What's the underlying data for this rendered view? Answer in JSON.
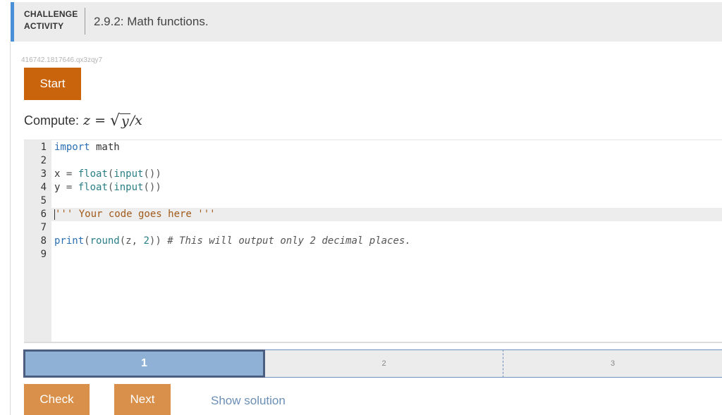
{
  "header": {
    "badge_line1": "CHALLENGE",
    "badge_line2": "ACTIVITY",
    "title": "2.9.2: Math functions.",
    "accent_color": "#4a90d9"
  },
  "activity_id": "416742.1817646.qx3zqy7",
  "start_button": {
    "label": "Start",
    "color": "#c9640c"
  },
  "prompt": {
    "label": "Compute:",
    "lhs": "z",
    "equals": "=",
    "radicand": "y",
    "divisor": "/x"
  },
  "editor": {
    "active_line": 6,
    "lines": [
      {
        "num": "1",
        "tokens": [
          {
            "t": "import",
            "c": "kw"
          },
          {
            "t": " math",
            "c": "plain"
          }
        ]
      },
      {
        "num": "2",
        "tokens": []
      },
      {
        "num": "3",
        "tokens": [
          {
            "t": "x ",
            "c": "plain"
          },
          {
            "t": "=",
            "c": "op"
          },
          {
            "t": " float",
            "c": "fn"
          },
          {
            "t": "(",
            "c": "op"
          },
          {
            "t": "input",
            "c": "fn"
          },
          {
            "t": "())",
            "c": "op"
          }
        ]
      },
      {
        "num": "4",
        "tokens": [
          {
            "t": "y ",
            "c": "plain"
          },
          {
            "t": "=",
            "c": "op"
          },
          {
            "t": " float",
            "c": "fn"
          },
          {
            "t": "(",
            "c": "op"
          },
          {
            "t": "input",
            "c": "fn"
          },
          {
            "t": "())",
            "c": "op"
          }
        ]
      },
      {
        "num": "5",
        "tokens": []
      },
      {
        "num": "6",
        "tokens": [
          {
            "t": "''' Your code goes here '''",
            "c": "str"
          }
        ]
      },
      {
        "num": "7",
        "tokens": []
      },
      {
        "num": "8",
        "tokens": [
          {
            "t": "print",
            "c": "kw"
          },
          {
            "t": "(",
            "c": "op"
          },
          {
            "t": "round",
            "c": "fn"
          },
          {
            "t": "(z, ",
            "c": "op"
          },
          {
            "t": "2",
            "c": "num"
          },
          {
            "t": "))",
            "c": "op"
          },
          {
            "t": " # This will output only 2 decimal places.",
            "c": "cm"
          }
        ]
      },
      {
        "num": "9",
        "tokens": []
      }
    ]
  },
  "progress": {
    "steps": [
      "1",
      "2",
      "3"
    ],
    "current": 1
  },
  "buttons": {
    "check": "Check",
    "next": "Next",
    "show_solution": "Show solution"
  }
}
